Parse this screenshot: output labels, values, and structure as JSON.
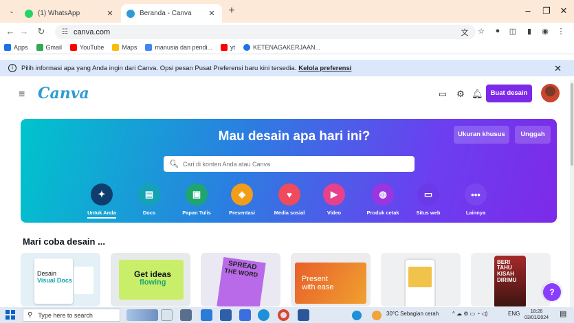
{
  "browser": {
    "tabs": [
      {
        "title": "(1) WhatsApp",
        "favicon": "whatsapp-icon",
        "color": "#25d366"
      },
      {
        "title": "Beranda - Canva",
        "favicon": "canva-icon",
        "color": "#2d9bd6"
      }
    ],
    "address": "canva.com",
    "bookmarks": [
      {
        "label": "Apps",
        "icon": "apps-grid-icon",
        "color": "#1a73e8"
      },
      {
        "label": "Gmail",
        "icon": "google-icon",
        "color": "#34a853"
      },
      {
        "label": "YouTube",
        "icon": "youtube-icon",
        "color": "#ff0000"
      },
      {
        "label": "Maps",
        "icon": "maps-pin-icon",
        "color": "#fbbc04"
      },
      {
        "label": "manusia dan pendi...",
        "icon": "classroom-icon",
        "color": "#4285f4"
      },
      {
        "label": "yt",
        "icon": "youtube-icon",
        "color": "#ff0000"
      },
      {
        "label": "KETENAGAKERJAAN...",
        "icon": "globe-icon",
        "color": "#1a73e8"
      }
    ]
  },
  "banner": {
    "text": "Pilih informasi apa yang Anda ingin dari Canva. Opsi pesan Pusat Preferensi baru kini tersedia.",
    "link": "Kelola preferensi"
  },
  "canva": {
    "logo": "Canva",
    "create_button": "Buat desain",
    "brand_color": "#7d2ae8",
    "hero": {
      "title": "Mau desain apa hari ini?",
      "custom_size": "Ukuran khusus",
      "upload": "Unggah",
      "search_placeholder": "Cari di konten Anda atau Canva",
      "categories": [
        {
          "label": "Untuk Anda",
          "icon": "sparkle-icon",
          "color": "#0f3d6e"
        },
        {
          "label": "Docs",
          "icon": "docs-icon",
          "color": "#13a3b5"
        },
        {
          "label": "Papan Tulis",
          "icon": "whiteboard-icon",
          "color": "#1fa66e"
        },
        {
          "label": "Presentasi",
          "icon": "presentation-icon",
          "color": "#f29d1a"
        },
        {
          "label": "Media sosial",
          "icon": "social-heart-icon",
          "color": "#ef4b5c"
        },
        {
          "label": "Video",
          "icon": "video-icon",
          "color": "#e8418c"
        },
        {
          "label": "Produk cetak",
          "icon": "print-icon",
          "color": "#9b35e0"
        },
        {
          "label": "Situs web",
          "icon": "website-icon",
          "color": "#6b39e6"
        },
        {
          "label": "Lainnya",
          "icon": "more-dots-icon",
          "color": "#7a45f0"
        }
      ]
    },
    "section_title": "Mari coba desain ...",
    "cards": [
      {
        "name": "docs-card",
        "t1": "Desain",
        "t2": "Visual Docs"
      },
      {
        "name": "whiteboard-card",
        "t1": "Get ideas",
        "t2": "flowing"
      },
      {
        "name": "poster-card",
        "t1": "SPREAD",
        "t2": "THE WORD"
      },
      {
        "name": "presentation-card",
        "t1": "Present",
        "t2": "with ease"
      },
      {
        "name": "social-card",
        "t1": "",
        "t2": ""
      },
      {
        "name": "video-card",
        "t1": "BERI TAHU",
        "t2": "KISAH DIRIMU"
      }
    ],
    "help": "?"
  },
  "taskbar": {
    "search": "Type here to search",
    "weather": "30°C  Sebagian cerah",
    "lang": "ENG",
    "time": "18:26",
    "date": "03/01/2024"
  }
}
